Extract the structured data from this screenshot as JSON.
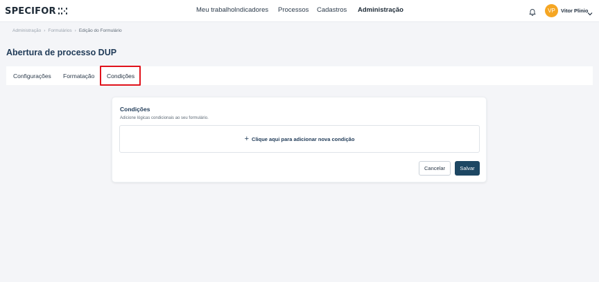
{
  "app": {
    "logo_text": "SPECIFOR"
  },
  "nav": {
    "items": [
      {
        "label": "Meu trabalho"
      },
      {
        "label": "Indicadores"
      },
      {
        "label": "Processos"
      },
      {
        "label": "Cadastros"
      },
      {
        "label": "Administração",
        "active": true
      }
    ]
  },
  "user": {
    "initials": "VP",
    "name": "Vitor Plinio",
    "avatar_color": "#f5a623",
    "icons": [
      "bell-icon",
      "chevron-down-icon"
    ]
  },
  "breadcrumb": {
    "items": [
      "Administração",
      "Formulários",
      "Edição do Formulário"
    ],
    "separator": "›"
  },
  "page": {
    "title": "Abertura de processo DUP"
  },
  "tabs": {
    "items": [
      {
        "label": "Configurações"
      },
      {
        "label": "Formatação"
      },
      {
        "label": "Condições",
        "active": true
      }
    ],
    "highlight_color": "#e0121b"
  },
  "card": {
    "title": "Condições",
    "subtitle": "Adicione lógicas condicionais ao seu formulário.",
    "add_icon": "plus-icon",
    "add_plus": "+",
    "add_label": "Clique aqui para adicionar nova condição",
    "cancel_label": "Cancelar",
    "save_label": "Salvar"
  },
  "colors": {
    "primary": "#1d4763",
    "title": "#1f3a57",
    "background": "#f4f5f8"
  }
}
